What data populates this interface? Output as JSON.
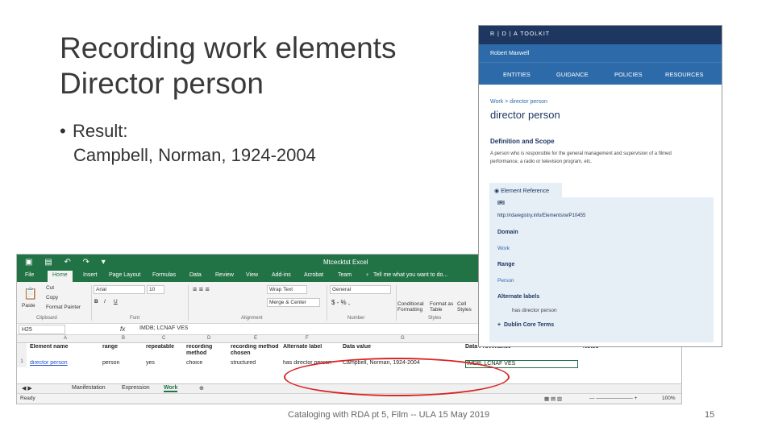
{
  "slide": {
    "title_line1": "Recording work elements",
    "title_line2": "Director person",
    "bullet_label": "Result:",
    "bullet_value": "Campbell, Norman, 1924-2004",
    "footer": "Cataloging with RDA pt 5, Film -- ULA 15 May 2019",
    "page_number": "15"
  },
  "excel": {
    "doc_title": "Mtcecktst Excel",
    "ribbon_tabs": [
      "File",
      "Home",
      "Insert",
      "Page Layout",
      "Formulas",
      "Data",
      "Review",
      "View",
      "Add-ins",
      "Acrobat",
      "Team"
    ],
    "tell_me": "Tell me what you want to do...",
    "font_name": "Arial",
    "font_size": "10",
    "wrap_text": "Wrap Text",
    "merge_center": "Merge & Center",
    "number_format": "General",
    "paste": "Paste",
    "cut": "Cut",
    "copy": "Copy",
    "format_painter": "Format Painter",
    "conditional_formatting": "Conditional Formatting",
    "format_as_table": "Format as Table",
    "cell_styles": "Cell Styles",
    "groups": [
      "Clipboard",
      "Font",
      "Alignment",
      "Number",
      "Styles"
    ],
    "name_box": "H25",
    "formula_value": "IMDB; LCNAF VES",
    "column_letters": [
      "A",
      "B",
      "C",
      "D",
      "E",
      "F",
      "G",
      "H",
      "I"
    ],
    "headers": [
      "Element name",
      "range",
      "repeatable",
      "recording method",
      "recording method chosen",
      "Alternate label",
      "Data value",
      "Data Provenance",
      "Notes"
    ],
    "row1": [
      "director person",
      "person",
      "yes",
      "choice",
      "structured",
      "has director person",
      "Campbell, Norman, 1924-2004",
      "IMDB; LCNAF VES",
      ""
    ],
    "sheet_tabs": [
      "Manifestation",
      "Expression",
      "Work"
    ],
    "status_ready": "Ready",
    "zoom": "100%"
  },
  "rda": {
    "logo": "R | D | A TOOLKIT",
    "user": "Robert Maxwell",
    "nav": [
      "ENTITIES",
      "GUIDANCE",
      "POLICIES",
      "RESOURCES"
    ],
    "breadcrumb": "Work > director person",
    "heading": "director person",
    "section": "Definition and Scope",
    "definition_line1": "A person who is responsible for the general management and supervision of a filmed",
    "definition_line2": "performance, a radio or television program, etc.",
    "ref_tab": "Element Reference",
    "iri_label": "IRI",
    "iri_value": "http://rdaregistry.info/Elements/w/P10455",
    "domain_label": "Domain",
    "domain_value": "Work",
    "range_label": "Range",
    "range_value": "Person",
    "alt_label": "Alternate labels",
    "alt_value": "has director person",
    "dublin": "Dublin Core Terms"
  },
  "colors": {
    "excel_green": "#217346",
    "rda_dark": "#1e3761",
    "rda_blue": "#2c6aa9",
    "highlight_oval": "#d92525"
  }
}
